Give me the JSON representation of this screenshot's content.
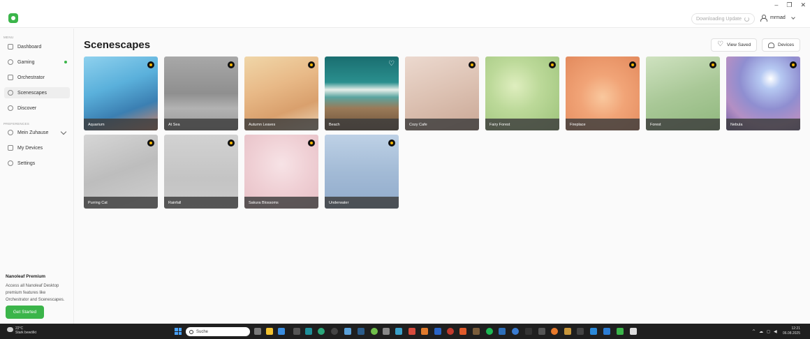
{
  "titlebar": {
    "update_status": "Downloading Update",
    "username": "mrmad",
    "window_controls": [
      "–",
      "❐",
      "✕"
    ]
  },
  "sidebar": {
    "menu_label": "MENU",
    "preferences_label": "PREFERENCES",
    "menu_items": [
      {
        "label": "Dashboard",
        "icon": "dashboard-icon"
      },
      {
        "label": "Gaming",
        "icon": "gamepad-icon",
        "status_color": "#3bb54a"
      },
      {
        "label": "Orchestrator",
        "icon": "wand-icon"
      },
      {
        "label": "Scenescapes",
        "icon": "scenescapes-icon",
        "active": true
      },
      {
        "label": "Discover",
        "icon": "compass-icon"
      }
    ],
    "preference_items": [
      {
        "label": "Mein Zuhause",
        "icon": "home-icon"
      },
      {
        "label": "My Devices",
        "icon": "devices-icon"
      },
      {
        "label": "Settings",
        "icon": "gear-icon"
      }
    ],
    "premium": {
      "title": "Nanoleaf Premium",
      "text": "Access all Nanoleaf Desktop premium features like Orchestrator and Scenescapes.",
      "button": "Get Started"
    }
  },
  "main": {
    "title": "Scenescapes",
    "view_saved": "View Saved",
    "devices": "Devices",
    "scenes": [
      {
        "label": "Aquarium",
        "badge": "premium"
      },
      {
        "label": "At Sea",
        "badge": "premium"
      },
      {
        "label": "Autumn Leaves",
        "badge": "premium"
      },
      {
        "label": "Beach",
        "badge": "favorite"
      },
      {
        "label": "Cozy Cafe",
        "badge": "premium"
      },
      {
        "label": "Fairy Forest",
        "badge": "premium"
      },
      {
        "label": "Fireplace",
        "badge": "premium"
      },
      {
        "label": "Forest",
        "badge": "premium"
      },
      {
        "label": "Nebula",
        "badge": "premium"
      },
      {
        "label": "Purring Cat",
        "badge": "premium"
      },
      {
        "label": "Rainfall",
        "badge": "premium"
      },
      {
        "label": "Sakura Blossoms",
        "badge": "premium"
      },
      {
        "label": "Underwater",
        "badge": "premium"
      }
    ]
  },
  "taskbar": {
    "weather_temp": "22°C",
    "weather_desc": "Stark bewölkt",
    "search_placeholder": "Suche",
    "time": "12:21",
    "date": "06.08.2025"
  },
  "colors": {
    "accent": "#3bb54a",
    "premium_badge": "#f4b400"
  }
}
